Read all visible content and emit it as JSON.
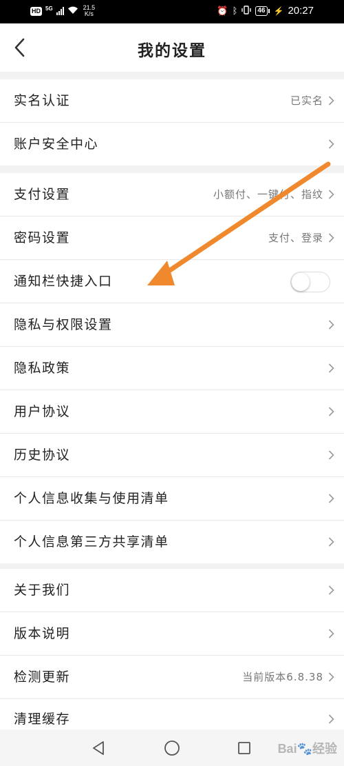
{
  "status_bar": {
    "hd": "HD",
    "network": "5G",
    "speed_value": "21.5",
    "speed_unit": "K/s",
    "battery": "46",
    "time": "20:27"
  },
  "header": {
    "title": "我的设置"
  },
  "groups": [
    {
      "items": [
        {
          "label": "实名认证",
          "value": "已实名"
        },
        {
          "label": "账户安全中心",
          "value": ""
        }
      ]
    },
    {
      "items": [
        {
          "label": "支付设置",
          "value": "小额付、一键付、指纹"
        },
        {
          "label": "密码设置",
          "value": "支付、登录"
        },
        {
          "label": "通知栏快捷入口",
          "value": "",
          "toggle_on": false
        },
        {
          "label": "隐私与权限设置",
          "value": ""
        },
        {
          "label": "隐私政策",
          "value": ""
        },
        {
          "label": "用户协议",
          "value": ""
        },
        {
          "label": "历史协议",
          "value": ""
        },
        {
          "label": "个人信息收集与使用清单",
          "value": ""
        },
        {
          "label": "个人信息第三方共享清单",
          "value": ""
        }
      ]
    },
    {
      "items": [
        {
          "label": "关于我们",
          "value": ""
        },
        {
          "label": "版本说明",
          "value": ""
        },
        {
          "label": "检测更新",
          "value": "当前版本6.8.38"
        },
        {
          "label": "清理缓存",
          "value": ""
        }
      ]
    }
  ],
  "annotation": {
    "arrow_color": "#f0892d"
  },
  "watermark": {
    "text_a": "Bai",
    "text_b": "经验"
  }
}
